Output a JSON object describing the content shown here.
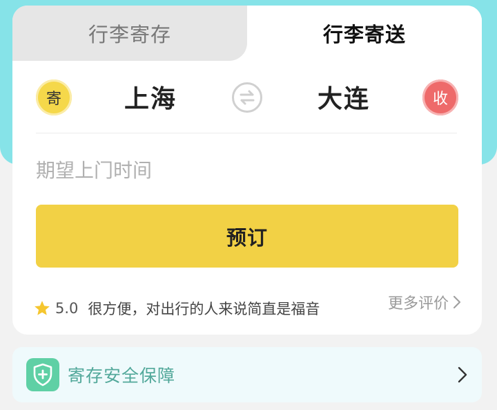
{
  "tabs": [
    {
      "label": "行李寄存",
      "active": false
    },
    {
      "label": "行李寄送",
      "active": true
    }
  ],
  "route": {
    "send_badge": "寄",
    "from_city": "上海",
    "to_city": "大连",
    "receive_badge": "收"
  },
  "time_input": {
    "placeholder": "期望上门时间"
  },
  "book_button": {
    "label": "预订"
  },
  "review": {
    "rating": "5.0",
    "text": "很方便，对出行的人来说简直是福音",
    "more_label": "更多评价"
  },
  "safety": {
    "label": "寄存安全保障"
  },
  "colors": {
    "accent_yellow": "#f2d145",
    "teal_background": "#86e3e8",
    "receive_red": "#ee6a6a",
    "safety_green": "#5fd0a5"
  },
  "icons": [
    "swap-icon",
    "star-icon",
    "chevron-right-icon",
    "shield-plus-icon"
  ]
}
